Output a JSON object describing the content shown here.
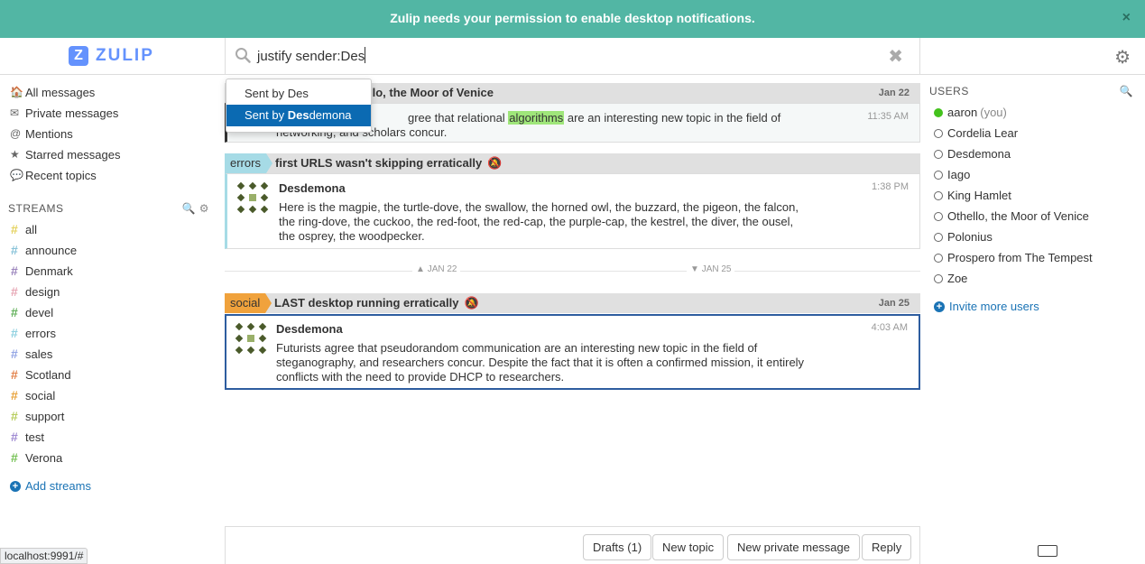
{
  "banner": {
    "text_before": "Zulip needs your permission to ",
    "link": "enable desktop notifications.",
    "close": "×"
  },
  "logo": {
    "mark": "Z",
    "text": "ZULIP"
  },
  "search": {
    "query": "justify sender:Des",
    "clear": "✖"
  },
  "typeahead": [
    {
      "label": "Sent by Des"
    },
    {
      "prefix": "Sent by ",
      "bold": "Des",
      "rest": "demona"
    }
  ],
  "left_nav": [
    {
      "icon": "home-icon",
      "glyph": "🏠",
      "label": "All messages"
    },
    {
      "icon": "envelope-icon",
      "glyph": "✉",
      "label": "Private messages"
    },
    {
      "icon": "at-icon",
      "glyph": "@",
      "label": "Mentions"
    },
    {
      "icon": "star-icon",
      "glyph": "★",
      "label": "Starred messages"
    },
    {
      "icon": "comment-icon",
      "glyph": "💬",
      "label": "Recent topics"
    }
  ],
  "streams": {
    "header": "STREAMS",
    "items": [
      {
        "name": "all",
        "color": "#e4d25e"
      },
      {
        "name": "announce",
        "color": "#87c2d8"
      },
      {
        "name": "Denmark",
        "color": "#9b84bc"
      },
      {
        "name": "design",
        "color": "#e7a7b5"
      },
      {
        "name": "devel",
        "color": "#62b05a"
      },
      {
        "name": "errors",
        "color": "#8fd1e0"
      },
      {
        "name": "sales",
        "color": "#94a6e5"
      },
      {
        "name": "Scotland",
        "color": "#e2814a"
      },
      {
        "name": "social",
        "color": "#e8a23a"
      },
      {
        "name": "support",
        "color": "#b7cd5e"
      },
      {
        "name": "test",
        "color": "#a08bd3"
      },
      {
        "name": "Verona",
        "color": "#76c155"
      }
    ],
    "add": "Add streams"
  },
  "messages": {
    "group1": {
      "topic": "llo, the Moor of Venice",
      "date": "Jan 22",
      "body_a": "gree that relational ",
      "highlight": "algorithms",
      "body_b": " are an interesting new topic in the field of",
      "body_c": "networking, and scholars concur.",
      "time": "11:35 AM"
    },
    "group2": {
      "stream": "errors",
      "stream_color": "#a6dbe6",
      "topic": "first URLS wasn't skipping erratically",
      "sender": "Desdemona",
      "time": "1:38 PM",
      "body": "Here is the magpie, the turtle-dove, the swallow, the horned owl, the buzzard, the pigeon, the falcon, the ring-dove, the cuckoo, the red-foot, the red-cap, the purple-cap, the kestrel, the diver, the ousel, the osprey, the woodpecker."
    },
    "date_sep": {
      "left": "JAN 22",
      "right": "JAN 25"
    },
    "group3": {
      "stream": "social",
      "stream_color": "#f0a23c",
      "topic": "LAST desktop running erratically",
      "date": "Jan 25",
      "sender": "Desdemona",
      "time": "4:03 AM",
      "body": "Futurists agree that pseudorandom communication are an interesting new topic in the field of steganography, and researchers concur. Despite the fact that it is often a confirmed mission, it entirely conflicts with the need to provide DHCP to researchers."
    }
  },
  "compose": {
    "drafts": "Drafts (1)",
    "new_topic": "New topic",
    "new_pm": "New private message",
    "reply": "Reply"
  },
  "users": {
    "header": "USERS",
    "items": [
      {
        "name": "aaron",
        "suffix": "(you)",
        "active": true
      },
      {
        "name": "Cordelia Lear"
      },
      {
        "name": "Desdemona"
      },
      {
        "name": "Iago"
      },
      {
        "name": "King Hamlet"
      },
      {
        "name": "Othello, the Moor of Venice"
      },
      {
        "name": "Polonius"
      },
      {
        "name": "Prospero from The Tempest"
      },
      {
        "name": "Zoe"
      }
    ],
    "invite": "Invite more users"
  },
  "statusbar": "localhost:9991/#"
}
